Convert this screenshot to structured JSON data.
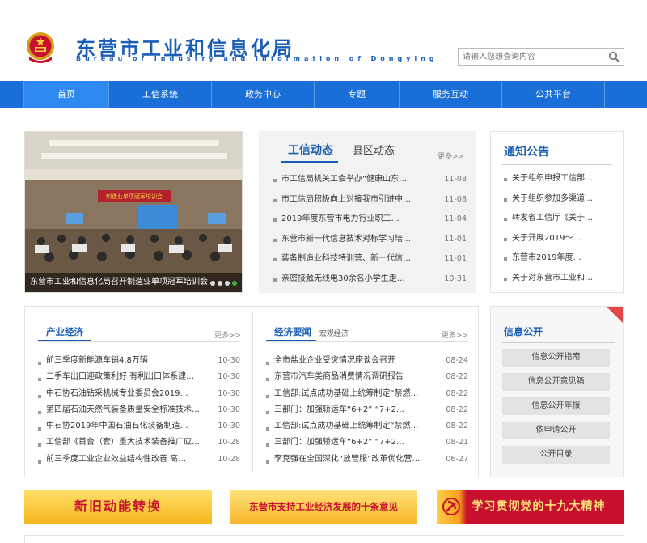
{
  "header": {
    "title_cn": "东营市工业和信息化局",
    "title_en": "Bureau of Industry and Information of Dongying",
    "search_placeholder": "请输入您想查询内容"
  },
  "nav": {
    "items": [
      "首页",
      "工信系统",
      "政务中心",
      "专题",
      "服务互动",
      "公共平台"
    ]
  },
  "slideshow": {
    "caption": "东营市工业和信息化局召开制造业单项冠军培训会",
    "banner_text": "制造业单项冠军培训会"
  },
  "news": {
    "tab_active": "工信动态",
    "tab_other": "县区动态",
    "more": "更多>>",
    "items": [
      {
        "title": "市工信局机关工会举办“健康山东…",
        "date": "11-08"
      },
      {
        "title": "市工信局积极向上对接我市引进中…",
        "date": "11-08"
      },
      {
        "title": "2019年度东营市电力行业职工…",
        "date": "11-04"
      },
      {
        "title": "东营市新一代信息技术对标学习培…",
        "date": "11-01"
      },
      {
        "title": "装备制造业科技特训营、新一代信…",
        "date": "11-01"
      },
      {
        "title": "亲密接触无线电30余名小学生走…",
        "date": "10-31"
      }
    ]
  },
  "notice": {
    "title": "通知公告",
    "items": [
      "关于组织申报工信部…",
      "关于组织参加多渠道…",
      "转发省工信厅《关于…",
      "关于开展2019～…",
      "东营市2019年度…",
      "关于对东营市工业和…"
    ]
  },
  "industry": {
    "title": "产业经济",
    "more": "更多>>",
    "items": [
      {
        "title": "前三季度新能源车销4.8万辆",
        "date": "10-30"
      },
      {
        "title": "二手车出口迎政策利好 有利出口体系建…",
        "date": "10-30"
      },
      {
        "title": "中石协石油钻采机械专业委员会2019…",
        "date": "10-30"
      },
      {
        "title": "第四届石油天然气装备质量安全标准技术…",
        "date": "10-30"
      },
      {
        "title": "中石协2019年中国石油石化装备制造…",
        "date": "10-30"
      },
      {
        "title": "工信部《首台（套）重大技术装备推广应…",
        "date": "10-28"
      },
      {
        "title": "前三季度工业企业效益结构性改善 高…",
        "date": "10-28"
      }
    ]
  },
  "economy": {
    "title": "经济要闻",
    "sub_tab": "宏观经济",
    "more": "更多>>",
    "items": [
      {
        "title": "全市盐业企业受灾情况座谈会召开",
        "date": "08-24"
      },
      {
        "title": "东营市汽车类商品消费情况调研报告",
        "date": "08-22"
      },
      {
        "title": "工信部:试点成功基础上统筹制定“禁燃…",
        "date": "08-22"
      },
      {
        "title": "三部门：加强轿运车“6+2” “7+2…",
        "date": "08-22"
      },
      {
        "title": "工信部:试点成功基础上统筹制定“禁燃…",
        "date": "08-22"
      },
      {
        "title": "三部门：加强轿运车“6+2” “7+2…",
        "date": "08-21"
      },
      {
        "title": "李克强在全国深化“放管服”改革优化营…",
        "date": "06-27"
      }
    ]
  },
  "info_public": {
    "title": "信息公开",
    "buttons": [
      "信息公开指南",
      "信息公开意见箱",
      "信息公开年报",
      "依申请公开",
      "公开目录"
    ]
  },
  "banners": [
    {
      "text": "新旧动能转换",
      "color": "#c8102e"
    },
    {
      "text": "东营市支持工业经济发展的十条意见",
      "color": "#c8102e"
    },
    {
      "text": "学习贯彻党的十九大精神",
      "color": "#ffe27a"
    }
  ],
  "colors": {
    "primary": "#1a5fb4",
    "nav_bg": "#1a6ed8",
    "nav_active": "#2d89ef",
    "accent_red": "#e04848"
  }
}
